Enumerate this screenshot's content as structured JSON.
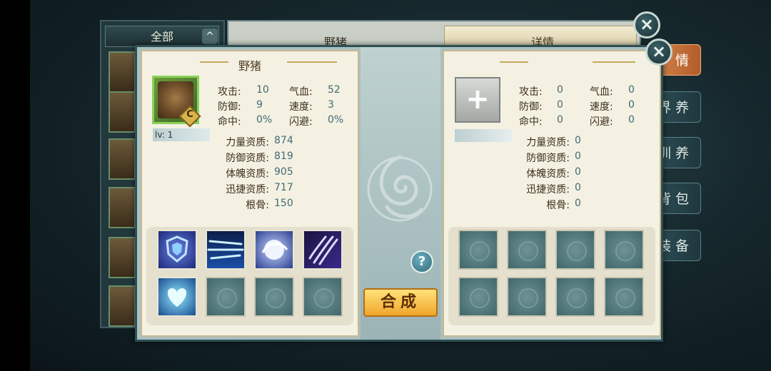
{
  "background_list": {
    "filter_label": "全部",
    "filter_toggle": "^"
  },
  "back_panel": {
    "title": "野猪",
    "tab": "详情"
  },
  "side_tabs": [
    "情",
    "界 养",
    "训 养",
    "背 包",
    "装 备"
  ],
  "close_icon": "×",
  "left_card": {
    "title": "野猪",
    "grade": "C",
    "level": "lv: 1",
    "stats": [
      {
        "label": "攻击:",
        "value": "10"
      },
      {
        "label": "气血:",
        "value": "52"
      },
      {
        "label": "防御:",
        "value": "9"
      },
      {
        "label": "速度:",
        "value": "3"
      },
      {
        "label": "命中:",
        "value": "0%"
      },
      {
        "label": "闪避:",
        "value": "0%"
      }
    ],
    "qualities": [
      {
        "label": "力量资质:",
        "value": "874"
      },
      {
        "label": "防御资质:",
        "value": "819"
      },
      {
        "label": "体魄资质:",
        "value": "905"
      },
      {
        "label": "迅捷资质:",
        "value": "717"
      },
      {
        "label": "根骨:",
        "value": "150"
      }
    ],
    "skills": [
      "shield-skill-icon",
      "speed-lines-skill-icon",
      "orb-skill-icon",
      "claw-skill-icon",
      "heart-skill-icon",
      "empty",
      "empty",
      "empty"
    ]
  },
  "right_card": {
    "add_symbol": "+",
    "stats": [
      {
        "label": "攻击:",
        "value": "0"
      },
      {
        "label": "气血:",
        "value": "0"
      },
      {
        "label": "防御:",
        "value": "0"
      },
      {
        "label": "速度:",
        "value": "0"
      },
      {
        "label": "命中:",
        "value": "0"
      },
      {
        "label": "闪避:",
        "value": "0"
      }
    ],
    "qualities": [
      {
        "label": "力量资质:",
        "value": "0"
      },
      {
        "label": "防御资质:",
        "value": "0"
      },
      {
        "label": "体魄资质:",
        "value": "0"
      },
      {
        "label": "迅捷资质:",
        "value": "0"
      },
      {
        "label": "根骨:",
        "value": "0"
      }
    ]
  },
  "synth_button": "合成",
  "help_button": "?"
}
